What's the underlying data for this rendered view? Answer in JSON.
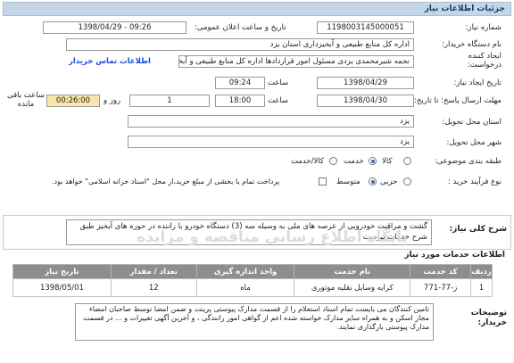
{
  "header": {
    "title": "جزئیات اطلاعات نیاز"
  },
  "form": {
    "need_number_label": "شماره نیاز:",
    "need_number": "1198003145000051",
    "announce_label": "تاریخ و ساعت اعلان عمومی:",
    "announce_value": "1398/04/29 - 09:26",
    "buyer_label": "نام دستگاه خریدار:",
    "buyer_value": "اداره کل منابع طبیعی و آبخیزداری استان یزد",
    "creator_label": "ایجاد کننده درخواست:",
    "creator_value": "نجمه شیرمحمدی یزدی مسئول امور قراردادها  اداره کل منابع طبیعی و آبخیزداری",
    "contact_link": "اطلاعات تماس خریدار",
    "created_date_label": "تاریخ ایجاد نیاز:",
    "created_date": "1398/04/29",
    "time_label": "ساعت",
    "created_time": "09:24",
    "deadline_label": "مهلت ارسال پاسخ: تا تاریخ:",
    "deadline_date": "1398/04/30",
    "deadline_time": "18:00",
    "day_label": "روز و",
    "day_value": "1",
    "remaining_value": "00:26:00",
    "remaining_label": "ساعت باقی مانده",
    "delivery_province_label": "استان محل تحویل:",
    "delivery_province": "یزد",
    "delivery_city_label": "شهر محل تحویل:",
    "delivery_city": "یزد",
    "category_label": "طبقه بندی موضوعی:",
    "category_options": [
      "کالا",
      "خدمت",
      "کالا/خدمت"
    ],
    "category_selected": "خدمت",
    "purchase_type_label": "نوع فرآیند خرید :",
    "purchase_options": [
      "جزیی",
      "متوسط"
    ],
    "purchase_selected": "متوسط",
    "payment_note": "پرداخت تمام یا بخشی از مبلغ خرید،از محل \"اسناد خزانه اسلامی\" خواهد بود."
  },
  "description": {
    "label": "شرح کلی نیاز:",
    "text": "گشت و مراقبت خودرویی از عرصه های ملی به وسیله سه (3)  دستگاه خودرو  با راننده در حوزه های آبخیز طبق شرح خدمات پیوست"
  },
  "items_section": {
    "title": "اطلاعات خدمات مورد نیاز"
  },
  "items_table": {
    "headers": [
      "ردیف",
      "کد خدمت",
      "نام خدمت",
      "واحد اندازه گیری",
      "تعداد / مقدار",
      "تاریخ نیاز"
    ],
    "rows": [
      [
        "1",
        "ز-77-771",
        "کرایه وسایل نقلیه موتوری",
        "ماه",
        "12",
        "1398/05/01"
      ]
    ]
  },
  "watermark": {
    "line1": "پایگاه اطلاع رسانی مناقصه و مزایده",
    "line2": "۰۲۱-۸۸۳۴۹۶۷۰"
  },
  "buyer_notes": {
    "label": "توضیحات خریدار:",
    "text": "تامین کنندگان می بایست تمام اسناد استعلام را از قسمت مدارک پیوستی پرینت و ضمن امضا توسط صاحبان امضاء مجاز اسکن و به همراه سایر مدارک خواسته شده اعم از گواهی امور رانندگی ، و آخرین آگهی تغییرات و ... در قسمت مدارک پیوستی بارگذاری نمایند."
  }
}
